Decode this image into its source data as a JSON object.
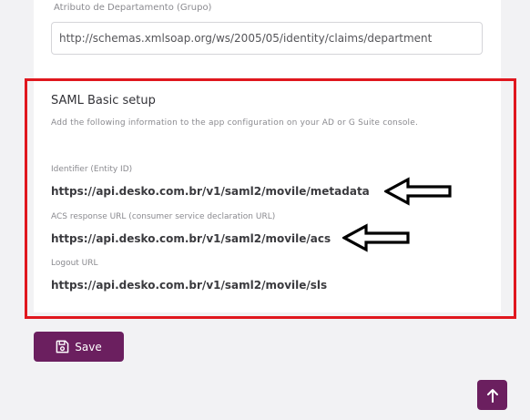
{
  "department": {
    "label": "Atributo de Departamento (Grupo)",
    "value": "http://schemas.xmlsoap.org/ws/2005/05/identity/claims/department"
  },
  "saml": {
    "title": "SAML Basic setup",
    "description": "Add the following information to the app configuration on your AD or G Suite console.",
    "fields": [
      {
        "label": "Identifier (Entity ID)",
        "value": "https://api.desko.com.br/v1/saml2/movile/metadata"
      },
      {
        "label": "ACS response URL (consumer service declaration URL)",
        "value": "https://api.desko.com.br/v1/saml2/movile/acs"
      },
      {
        "label": "Logout URL",
        "value": "https://api.desko.com.br/v1/saml2/movile/sls"
      }
    ]
  },
  "actions": {
    "save_label": "Save",
    "save_icon": "floppy-disk-icon",
    "scroll_top_icon": "arrow-up-icon"
  },
  "colors": {
    "primary": "#6b1f5f",
    "highlight_border": "#e0171e"
  }
}
